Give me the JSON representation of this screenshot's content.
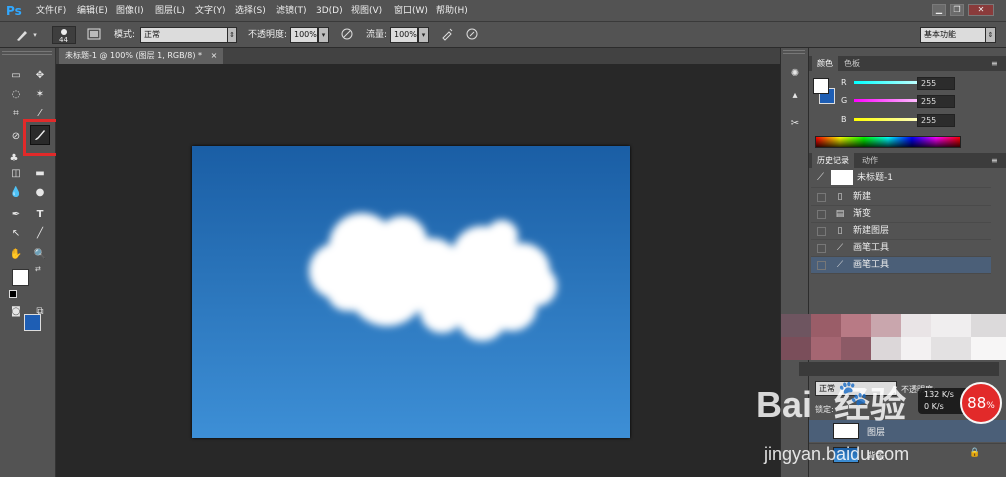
{
  "app": {
    "logo": "Ps"
  },
  "menu": {
    "items": [
      "文件(F)",
      "编辑(E)",
      "图像(I)",
      "图层(L)",
      "文字(Y)",
      "选择(S)",
      "滤镜(T)",
      "3D(D)",
      "视图(V)",
      "窗口(W)",
      "帮助(H)"
    ]
  },
  "window_controls": {
    "minimize": "▁",
    "restore": "❐",
    "close": "✕"
  },
  "options": {
    "brush_size": "44",
    "mode_label": "模式:",
    "mode_value": "正常",
    "opacity_label": "不透明度:",
    "opacity_value": "100%",
    "flow_label": "流量:",
    "flow_value": "100%",
    "workspace": "基本功能"
  },
  "document": {
    "tab_title": "未标题-1 @ 100% (图层 1, RGB/8) *",
    "tab_close": "×"
  },
  "color_panel": {
    "tabs": [
      "颜色",
      "色板"
    ],
    "channels": [
      {
        "label": "R",
        "value": "255"
      },
      {
        "label": "G",
        "value": "255"
      },
      {
        "label": "B",
        "value": "255"
      }
    ]
  },
  "history_panel": {
    "tabs": [
      "历史记录",
      "动作"
    ],
    "snapshot": "未标题-1",
    "items": [
      {
        "label": "新建",
        "icon": "document-icon"
      },
      {
        "label": "渐变",
        "icon": "gradient-icon"
      },
      {
        "label": "新建图层",
        "icon": "document-icon"
      },
      {
        "label": "画笔工具",
        "icon": "brush-icon"
      },
      {
        "label": "画笔工具",
        "icon": "brush-icon"
      }
    ]
  },
  "layers_panel": {
    "blend_mode": "正常",
    "opacity_label": "不透明度:",
    "lock_label": "锁定:",
    "layer_partial": "图层",
    "bg_layer_partial": "背景"
  },
  "overlays": {
    "network_speed": "132 K/s",
    "network_speed_2": "0 K/s",
    "percent_badge": "88",
    "percent_sign": "%",
    "watermark_brand": "Bai",
    "watermark_brand_2": "经验",
    "watermark_url": "jingyan.baidu.com"
  },
  "colors": {
    "accent_red": "#e22a2a",
    "canvas_top": "#1a5ea5",
    "canvas_bottom": "#3d8fd6",
    "foreground": "#ffffff",
    "background_color": "#1e5eb4",
    "history_selected": "#4b5f78"
  }
}
